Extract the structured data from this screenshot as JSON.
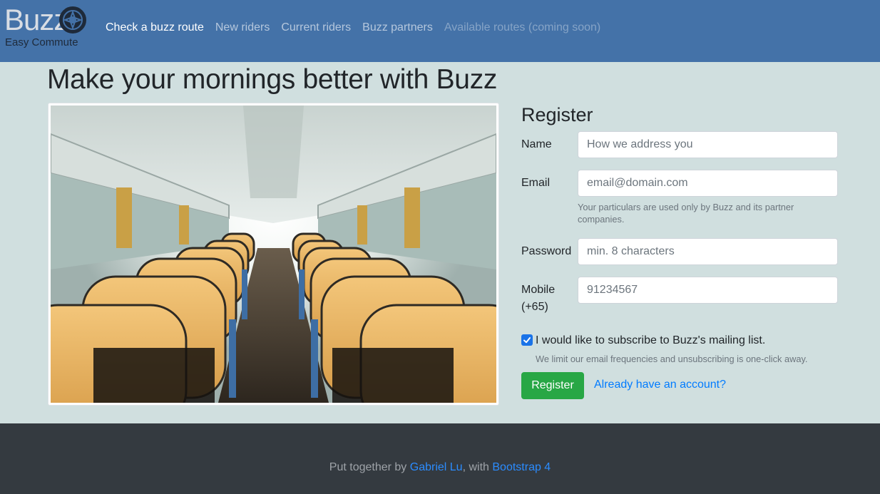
{
  "brand": {
    "name": "Buzz",
    "tagline": "Easy Commute"
  },
  "nav": {
    "items": [
      {
        "label": "Check a buzz route"
      },
      {
        "label": "New riders"
      },
      {
        "label": "Current riders"
      },
      {
        "label": "Buzz partners"
      },
      {
        "label": "Available routes (coming soon)"
      }
    ]
  },
  "main": {
    "title": "Make your mornings better with Buzz"
  },
  "register": {
    "title": "Register",
    "name": {
      "label": "Name",
      "placeholder": "How we address you"
    },
    "email": {
      "label": "Email",
      "placeholder": "email@domain.com",
      "help": "Your particulars are used only by Buzz and its partner companies."
    },
    "password": {
      "label": "Password",
      "placeholder": "min. 8 characters"
    },
    "mobile": {
      "label": "Mobile (+65)",
      "placeholder": "91234567"
    },
    "subscribe": {
      "checked": true,
      "label": "I would like to subscribe to Buzz's mailing list.",
      "help": "We limit our email frequencies and unsubscribing is one-click away."
    },
    "submit_label": "Register",
    "login_link": "Already have an account?"
  },
  "footer": {
    "prefix": "Put together by ",
    "author": "Gabriel Lu",
    "middle": ", with ",
    "framework": "Bootstrap 4"
  },
  "colors": {
    "navbar": "#4472a8",
    "page_bg": "#d0dfdf",
    "footer_bg": "#343a40",
    "primary_link": "#007bff",
    "success": "#28a745"
  }
}
